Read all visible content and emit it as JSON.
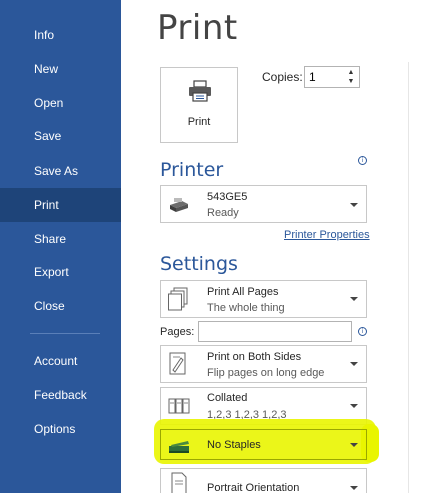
{
  "nav": {
    "items": [
      {
        "label": "Info",
        "active": false
      },
      {
        "label": "New",
        "active": false
      },
      {
        "label": "Open",
        "active": false
      },
      {
        "label": "Save",
        "active": false
      },
      {
        "label": "Save As",
        "active": false
      },
      {
        "label": "Print",
        "active": true
      },
      {
        "label": "Share",
        "active": false
      },
      {
        "label": "Export",
        "active": false
      },
      {
        "label": "Close",
        "active": false
      },
      {
        "label": "Account",
        "active": false
      },
      {
        "label": "Feedback",
        "active": false
      },
      {
        "label": "Options",
        "active": false
      }
    ]
  },
  "main": {
    "title": "Print",
    "print_button_label": "Print",
    "copies_label": "Copies:",
    "copies_value": "1",
    "printer_heading": "Printer",
    "printer": {
      "name": "543GE5",
      "status": "Ready"
    },
    "printer_properties_link": "Printer Properties",
    "settings_heading": "Settings",
    "settings": [
      {
        "line1": "Print All Pages",
        "line2": "The whole thing"
      },
      {
        "line1": "Print on Both Sides",
        "line2": "Flip pages on long edge"
      },
      {
        "line1": "Collated",
        "line2": "1,2,3   1,2,3   1,2,3"
      },
      {
        "line1": "No Staples",
        "line2": ""
      },
      {
        "line1": "Portrait Orientation",
        "line2": ""
      }
    ],
    "pages_label": "Pages:",
    "pages_value": ""
  },
  "colors": {
    "nav_bg": "#2b579a",
    "nav_active": "#1e4479",
    "accent": "#2b579a",
    "highlight": "#e9f500"
  }
}
